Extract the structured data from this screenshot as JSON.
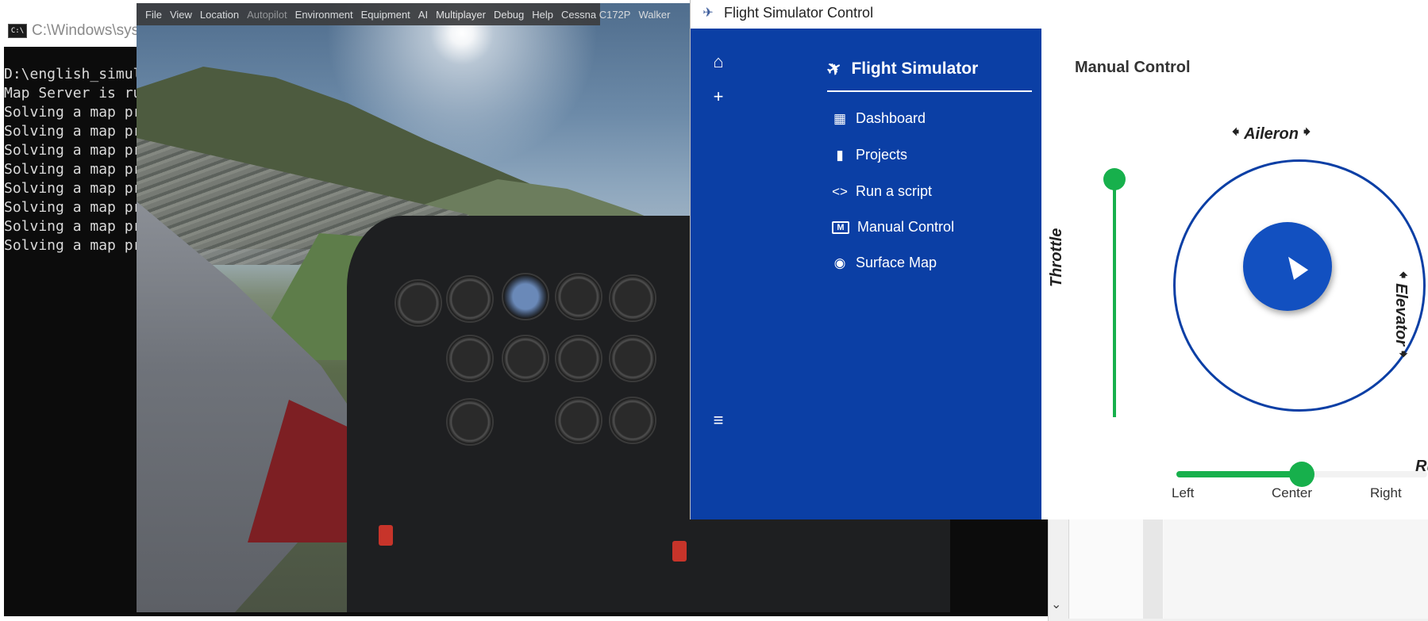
{
  "console": {
    "title": "C:\\Windows\\syst",
    "lines": [
      "D:\\english_simul",
      "Map Server is ru",
      "Solving a map pr",
      "Solving a map pr",
      "Solving a map pr",
      "Solving a map pr",
      "Solving a map pr",
      "Solving a map pr",
      "Solving a map pr",
      "Solving a map pr"
    ]
  },
  "sim": {
    "menu": [
      "File",
      "View",
      "Location",
      "Autopilot",
      "Environment",
      "Equipment",
      "AI",
      "Multiplayer",
      "Debug",
      "Help",
      "Cessna C172P",
      "Walker"
    ],
    "disabled_menu": "Autopilot"
  },
  "control": {
    "window_title": "Flight Simulator Control",
    "brand": "Flight Simulator",
    "nav": [
      "Dashboard",
      "Projects",
      "Run a script",
      "Manual Control",
      "Surface Map"
    ],
    "main_title": "Manual Control",
    "aileron_label": "Aileron",
    "elevator_label": "Elevator",
    "throttle_label": "Throttle",
    "rudder_label": "Rudd",
    "rudder_ticks": [
      "Left",
      "Center",
      "Right"
    ],
    "throttle_value": 1.0,
    "rudder_value": 0.5
  },
  "colors": {
    "sidebar": "#0b3fa5",
    "accent_green": "#17b04c",
    "joystick": "#1250c0"
  }
}
